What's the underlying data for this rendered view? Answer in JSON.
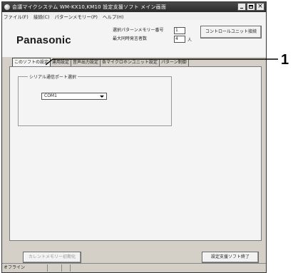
{
  "window": {
    "title": "会議マイクシステム WM-KX10,KM10 設定支援ソフト メイン画面",
    "close_glyph": "×"
  },
  "menu": [
    {
      "label": "ファイル(F)"
    },
    {
      "label": "接続(C)"
    },
    {
      "label": "パターンメモリー(P)"
    },
    {
      "label": "ヘルプ(H)"
    }
  ],
  "header": {
    "logo": "Panasonic",
    "pattern_label": "選択パターンメモリー番号",
    "pattern_value": "1",
    "speakers_label": "最大同時発言者数",
    "speakers_value": "4",
    "speakers_unit": "人",
    "connect_button": "コントロールユニット接続"
  },
  "tabs": [
    {
      "label": "このソフトの設定",
      "active": true
    },
    {
      "label": "運用設定",
      "active": false
    },
    {
      "label": "音声出力設定",
      "active": false
    },
    {
      "label": "各マイクロホンユニット設定",
      "active": false
    },
    {
      "label": "パターン制御",
      "active": false
    }
  ],
  "serial_group": {
    "label": "シリアル通信ポート選択",
    "selected": "COM1"
  },
  "callout": {
    "number": "1"
  },
  "footer": {
    "reset_button": "カレントメモリー初期化",
    "exit_button": "設定支援ソフト終了"
  },
  "statusbar": {
    "status": "オフライン"
  }
}
